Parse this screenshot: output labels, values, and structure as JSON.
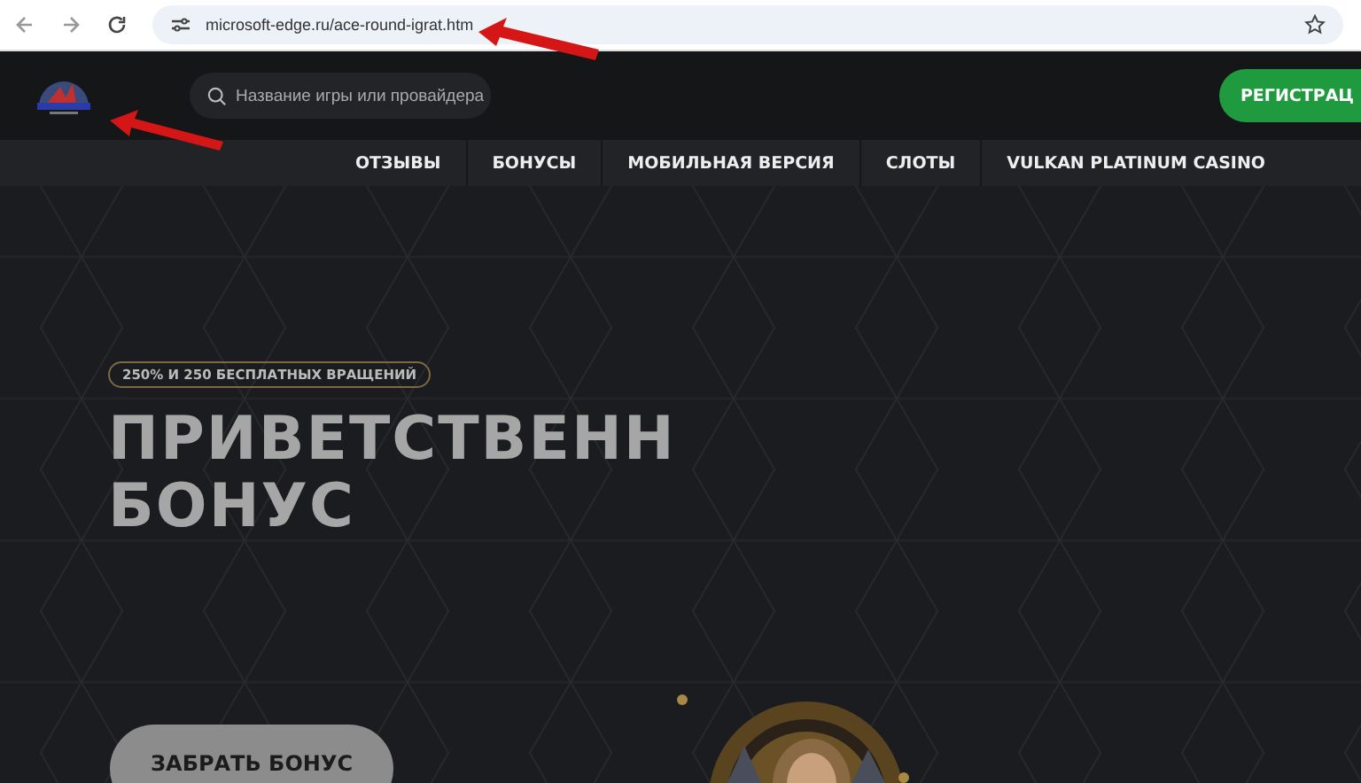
{
  "browser": {
    "url": "microsoft-edge.ru/ace-round-igrat.htm"
  },
  "header": {
    "search": {
      "placeholder": "Название игры или провайдера"
    },
    "register_button": "РЕГИСТРАЦ"
  },
  "nav": {
    "items": [
      {
        "label": "ОТЗЫВЫ"
      },
      {
        "label": "БОНУСЫ"
      },
      {
        "label": "МОБИЛЬНАЯ ВЕРСИЯ"
      },
      {
        "label": "СЛОТЫ"
      },
      {
        "label": "VULKAN PLATINUM CASINO"
      }
    ]
  },
  "hero": {
    "badge": "250% И 250 БЕСПЛАТНЫХ ВРАЩЕНИЙ",
    "title_lines": [
      "ПРИВЕТСТВЕНН",
      "БОНУС"
    ],
    "button": "ЗАБРАТЬ БОНУС"
  }
}
